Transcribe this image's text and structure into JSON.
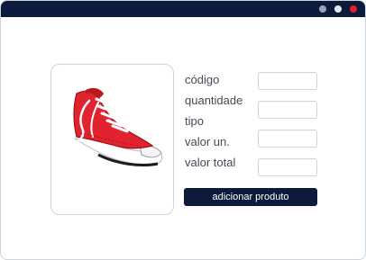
{
  "form": {
    "labels": {
      "codigo": "código",
      "quantidade": "quantidade",
      "tipo": "tipo",
      "valor_un": "valor un.",
      "valor_total": "valor total"
    },
    "fields": {
      "codigo": "",
      "quantidade": "",
      "valor_un": "",
      "valor_total": ""
    },
    "submit_label": "adicionar produto"
  },
  "product": {
    "image_icon": "red-sneaker-icon"
  },
  "colors": {
    "titlebar": "#0c1a3b",
    "button": "#0c1a3b",
    "border": "#cfd3da",
    "close_dot": "#e0232e"
  }
}
